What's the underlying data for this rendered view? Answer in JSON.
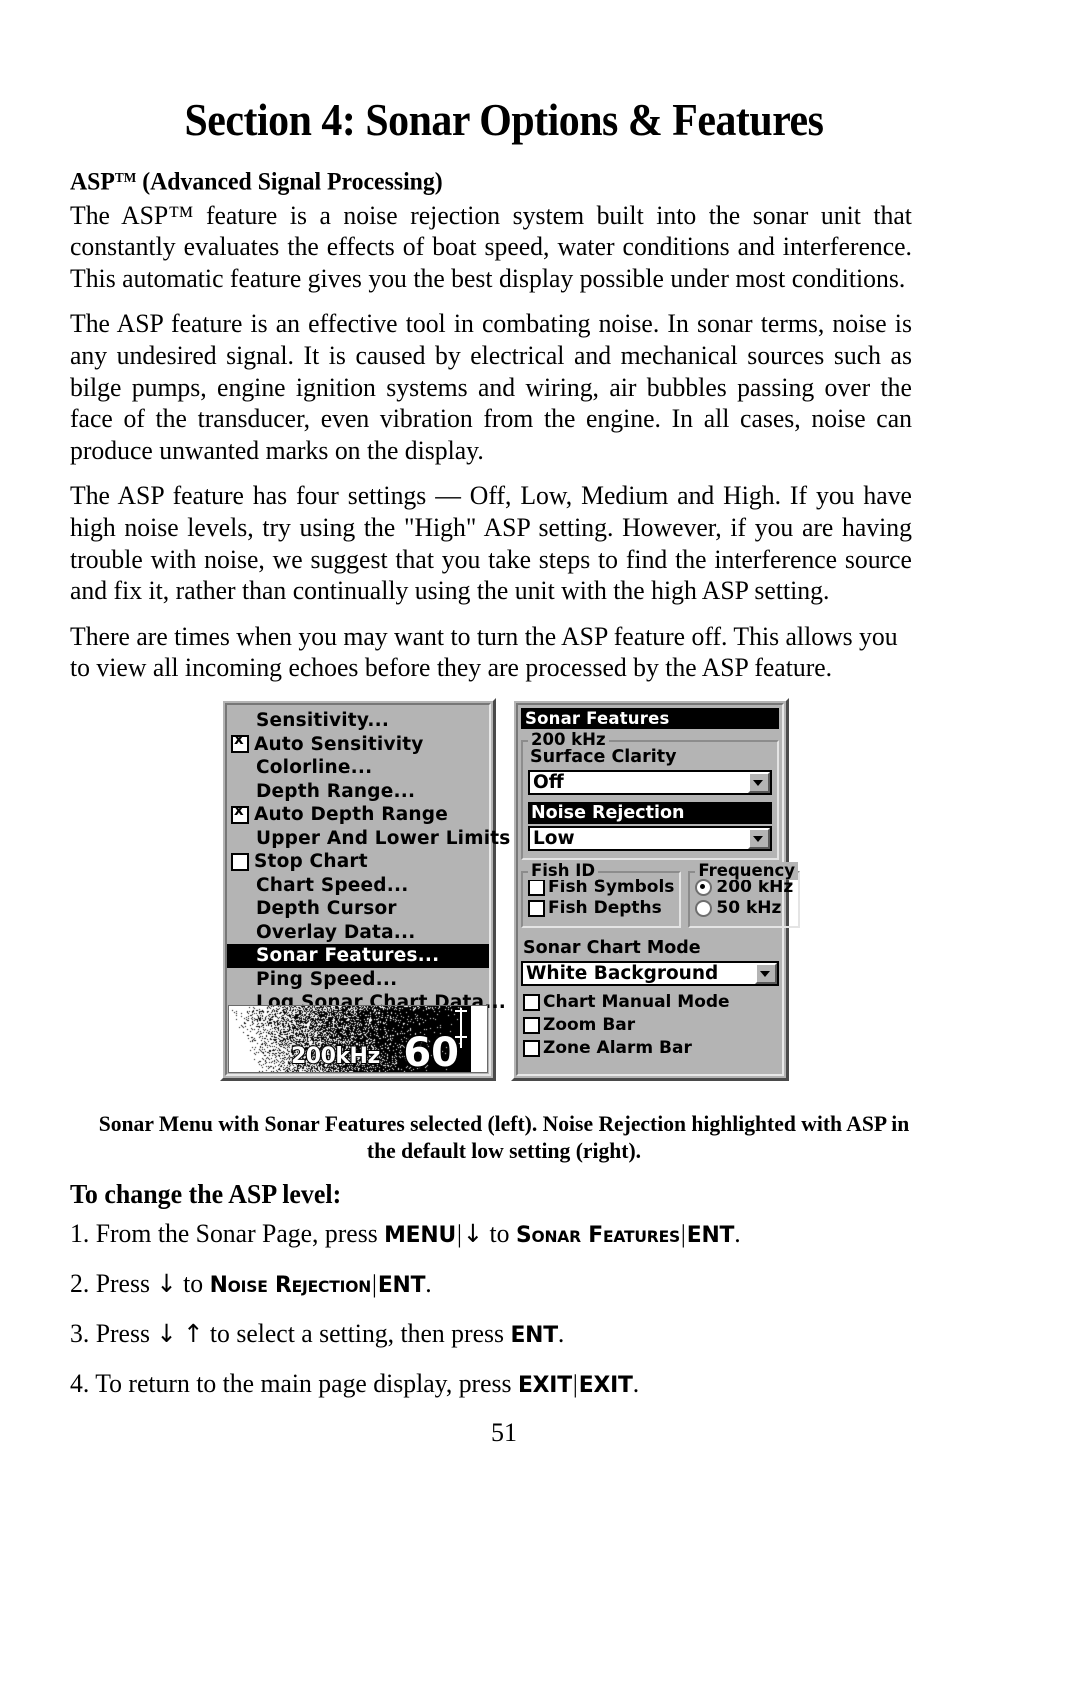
{
  "document": {
    "title": "Section 4: Sonar Options & Features",
    "subheading_pre": "ASP",
    "subheading_tm": "TM",
    "subheading_post": " (Advanced Signal Processing)",
    "page_number": "51"
  },
  "paragraphs": [
    "The ASP™ feature is a noise rejection system built into the sonar unit that constantly evaluates the effects of boat speed, water conditions and interference. This automatic feature gives you the best display possible under most conditions.",
    "The ASP feature is an effective tool in combating noise. In sonar terms, noise is any undesired signal. It is caused by electrical and mechanical sources such as bilge pumps, engine ignition systems and wiring, air bubbles passing over the face of the transducer, even vibration from the engine. In all cases, noise can produce unwanted marks on the display.",
    "The ASP feature has four settings — Off, Low, Medium and High. If you have high noise levels, try using the \"High\" ASP setting. However, if you are having trouble with noise, we suggest that you take steps to find the interference source and fix it, rather than continually using the unit with the high ASP setting.",
    "There are times when you may want to turn the ASP feature off. This allows you to view all incoming echoes before they are processed by the ASP feature."
  ],
  "sonar_menu": {
    "items": [
      {
        "label": "Sensitivity...",
        "control": "none",
        "checked": false
      },
      {
        "label": "Auto Sensitivity",
        "control": "checkbox",
        "checked": true
      },
      {
        "label": "Colorline...",
        "control": "none",
        "checked": false
      },
      {
        "label": "Depth Range...",
        "control": "none",
        "checked": false
      },
      {
        "label": "Auto Depth Range",
        "control": "checkbox",
        "checked": true
      },
      {
        "label": "Upper And Lower Limits...",
        "control": "none",
        "checked": false
      },
      {
        "label": "Stop Chart",
        "control": "checkbox",
        "checked": false
      },
      {
        "label": "Chart Speed...",
        "control": "none",
        "checked": false
      },
      {
        "label": "Depth Cursor",
        "control": "none",
        "checked": false
      },
      {
        "label": "Overlay Data...",
        "control": "none",
        "checked": false
      },
      {
        "label": "Sonar Features...",
        "control": "none",
        "checked": false,
        "selected": true
      },
      {
        "label": "Ping Speed...",
        "control": "none",
        "checked": false
      },
      {
        "label": "Log Sonar Chart Data...",
        "control": "none",
        "checked": false
      }
    ],
    "sonar_chart": {
      "frequency_label": "200kHz",
      "depth_value": "60"
    }
  },
  "sonar_features": {
    "title": "Sonar Features",
    "frequency_group_label": "200 kHz",
    "surface_clarity": {
      "label": "Surface Clarity",
      "value": "Off",
      "highlighted": false
    },
    "noise_rejection": {
      "label": "Noise Rejection",
      "value": "Low",
      "highlighted": true
    },
    "fish_id": {
      "label": "Fish ID",
      "options": [
        {
          "label": "Fish Symbols",
          "checked": false
        },
        {
          "label": "Fish Depths",
          "checked": false
        }
      ]
    },
    "frequency": {
      "label": "Frequency",
      "options": [
        {
          "label": "200 kHz",
          "selected": true
        },
        {
          "label": "50 kHz",
          "selected": false
        }
      ]
    },
    "sonar_chart_mode": {
      "label": "Sonar Chart Mode",
      "value": "White Background"
    },
    "bottom_checks": [
      {
        "label": "Chart Manual Mode",
        "checked": false
      },
      {
        "label": "Zoom Bar",
        "checked": false
      },
      {
        "label": "Zone Alarm Bar",
        "checked": false
      }
    ]
  },
  "figure_caption": "Sonar Menu with Sonar Features selected (left). Noise Rejection highlighted with ASP in the default low setting (right).",
  "procedure": {
    "heading": "To change the ASP level:",
    "steps": [
      {
        "number": "1.",
        "parts": [
          {
            "type": "text",
            "value": "From the Sonar Page, press "
          },
          {
            "type": "key",
            "value": "MENU"
          },
          {
            "type": "pipe",
            "value": "|"
          },
          {
            "type": "arrow",
            "value": "↓"
          },
          {
            "type": "text",
            "value": " to "
          },
          {
            "type": "smallcaps",
            "value": "Sonar Features"
          },
          {
            "type": "pipe",
            "value": "|"
          },
          {
            "type": "key",
            "value": "ENT"
          },
          {
            "type": "text",
            "value": "."
          }
        ]
      },
      {
        "number": "2.",
        "parts": [
          {
            "type": "text",
            "value": "Press "
          },
          {
            "type": "arrow",
            "value": "↓"
          },
          {
            "type": "text",
            "value": " to "
          },
          {
            "type": "smallcaps",
            "value": "Noise Rejection"
          },
          {
            "type": "pipe",
            "value": "|"
          },
          {
            "type": "key",
            "value": "ENT"
          },
          {
            "type": "text",
            "value": "."
          }
        ]
      },
      {
        "number": "3.",
        "parts": [
          {
            "type": "text",
            "value": "Press "
          },
          {
            "type": "arrow",
            "value": "↓"
          },
          {
            "type": "text",
            "value": " "
          },
          {
            "type": "arrow",
            "value": "↑"
          },
          {
            "type": "text",
            "value": " to select a setting, then press "
          },
          {
            "type": "key",
            "value": "ENT"
          },
          {
            "type": "text",
            "value": "."
          }
        ]
      },
      {
        "number": "4.",
        "parts": [
          {
            "type": "text",
            "value": "To return to the main page display, press "
          },
          {
            "type": "key",
            "value": "EXIT"
          },
          {
            "type": "pipe",
            "value": "|"
          },
          {
            "type": "key",
            "value": "EXIT"
          },
          {
            "type": "text",
            "value": "."
          }
        ]
      }
    ]
  },
  "colors": {
    "panel_face": "#b4b4b4",
    "highlight_bg": "#000000",
    "highlight_fg": "#ffffff",
    "field_bg": "#ffffff"
  }
}
